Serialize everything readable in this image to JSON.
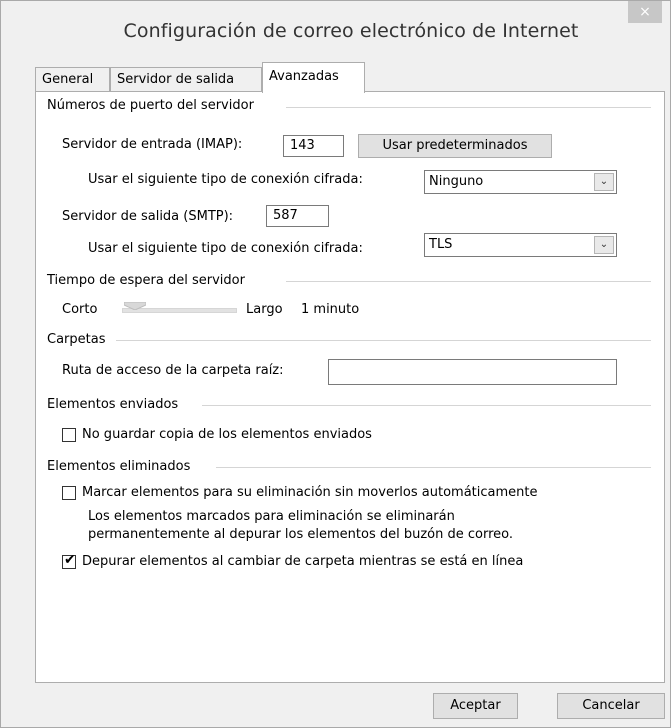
{
  "window": {
    "title": "Configuración de correo electrónico de Internet",
    "close_glyph": "×"
  },
  "tabs": [
    {
      "label": "General",
      "active": false
    },
    {
      "label": "Servidor de salida",
      "active": false
    },
    {
      "label": "Avanzadas",
      "active": true
    }
  ],
  "ports": {
    "title": "Números de puerto del servidor",
    "incoming_label": "Servidor de entrada (IMAP):",
    "incoming_value": "143",
    "defaults_button": "Usar predeterminados",
    "incoming_enc_label": "Usar el siguiente tipo de conexión cifrada:",
    "incoming_enc_value": "Ninguno",
    "outgoing_label": "Servidor de salida (SMTP):",
    "outgoing_value": "587",
    "outgoing_enc_label": "Usar el siguiente tipo de conexión cifrada:",
    "outgoing_enc_value": "TLS"
  },
  "timeout": {
    "title": "Tiempo de espera del servidor",
    "short_label": "Corto",
    "long_label": "Largo",
    "value_text": "1 minuto"
  },
  "folders": {
    "title": "Carpetas",
    "root_label": "Ruta de acceso de la carpeta raíz:",
    "root_value": ""
  },
  "sent": {
    "title": "Elementos enviados",
    "no_save_label": "No guardar copia de los elementos enviados",
    "no_save_checked": false
  },
  "deleted": {
    "title": "Elementos eliminados",
    "mark_label": "Marcar elementos para su eliminación sin moverlos automáticamente",
    "mark_checked": false,
    "mark_note_line1": "Los elementos marcados para eliminación se eliminarán",
    "mark_note_line2": "permanentemente al depurar los elementos del buzón de correo.",
    "purge_label": "Depurar elementos al cambiar de carpeta mientras se está en línea",
    "purge_checked": true
  },
  "footer": {
    "ok_label": "Aceptar",
    "cancel_label": "Cancelar"
  },
  "icons": {
    "close": "close-icon",
    "dropdown": "chevron-down-icon",
    "check": "check-icon"
  }
}
